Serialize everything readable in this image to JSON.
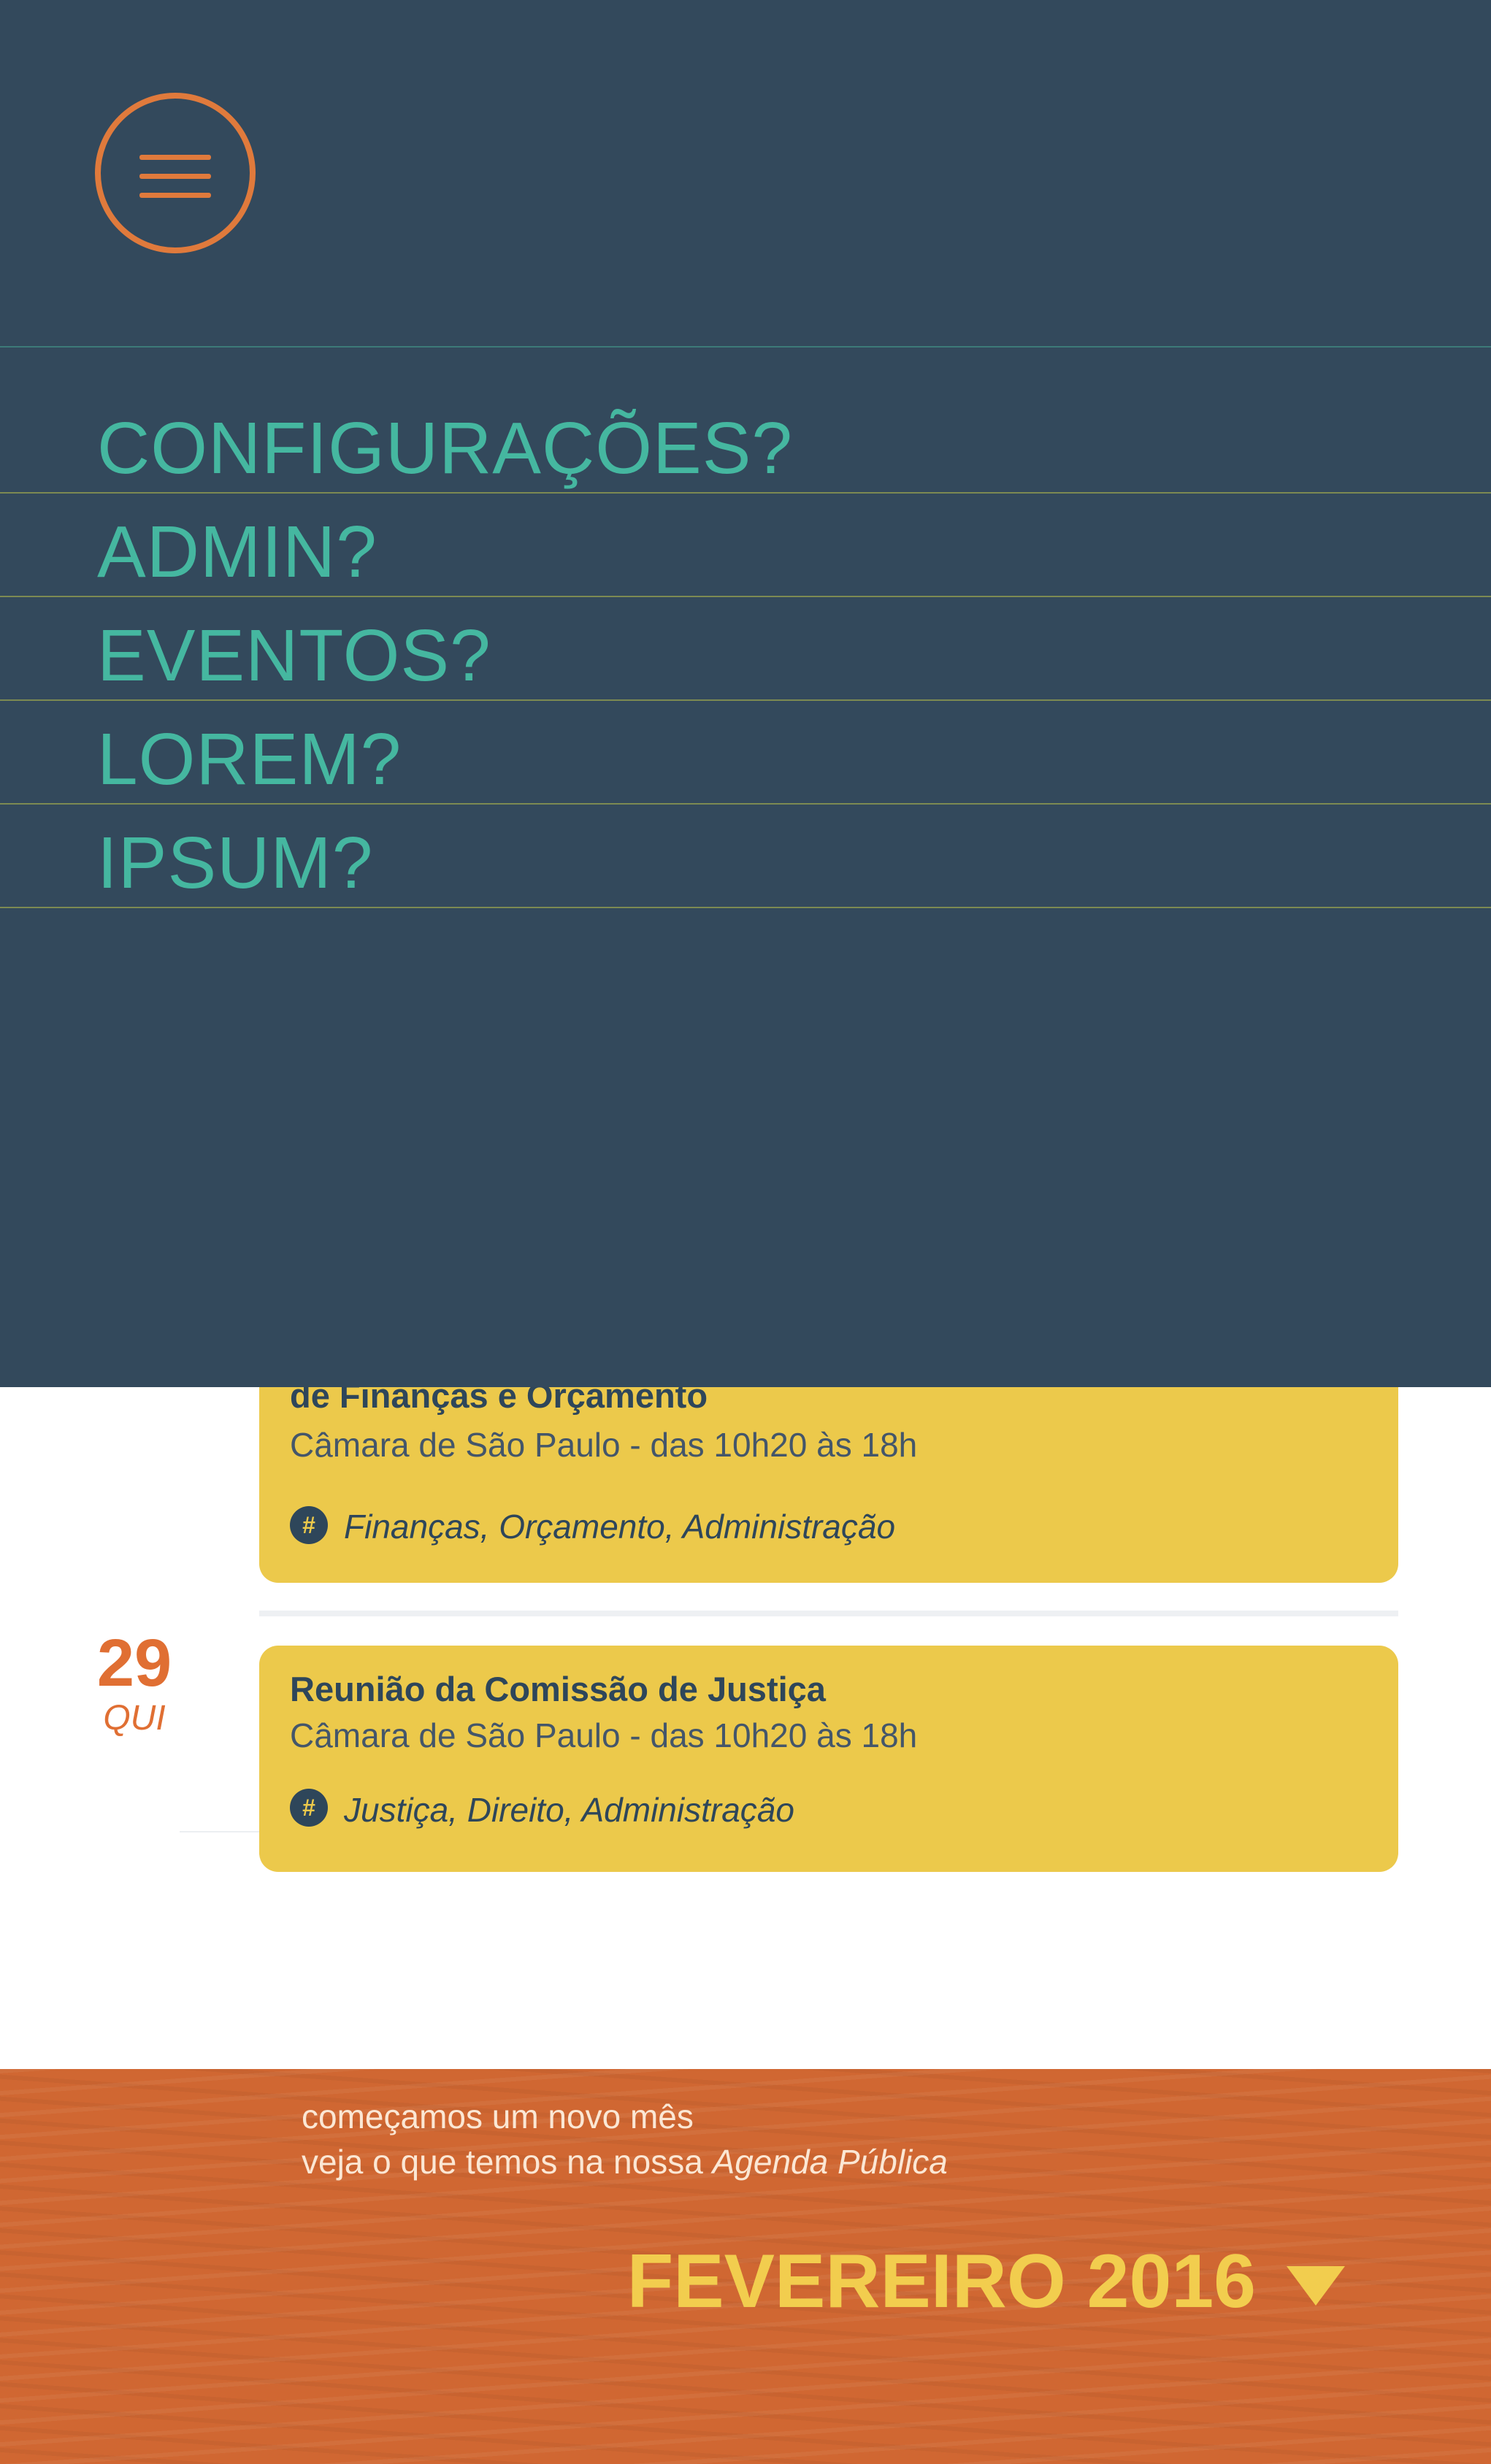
{
  "nav": {
    "menu_items": [
      {
        "label": "CONFIGURAÇÕES?"
      },
      {
        "label": "ADMIN?"
      },
      {
        "label": "EVENTOS?"
      },
      {
        "label": "LOREM?"
      },
      {
        "label": "IPSUM?"
      }
    ]
  },
  "events": [
    {
      "title": "de Finanças e Orçamento",
      "location": "Câmara de São Paulo - das 10h20 às 18h",
      "tags": "Finanças, Orçamento, Administração"
    },
    {
      "day": "29",
      "weekday": "QUI",
      "title": "Reunião da Comissão de Justiça",
      "location": "Câmara de São Paulo - das 10h20 às 18h",
      "tags": "Justiça, Direito, Administração"
    }
  ],
  "banner": {
    "line1": "começamos um novo mês",
    "line2_prefix": "veja o que temos na nossa ",
    "line2_italic": "Agenda Pública",
    "month": "FEVEREIRO 2016"
  },
  "colors": {
    "overlay": "#33495c",
    "accent_orange": "#e07a3c",
    "menu_text": "#45b7a0",
    "card": "#ecc94b",
    "banner": "#d06732",
    "month_text": "#f2cd4e"
  },
  "icons": [
    "hamburger-menu-icon",
    "hashtag-icon",
    "caret-down-icon"
  ]
}
